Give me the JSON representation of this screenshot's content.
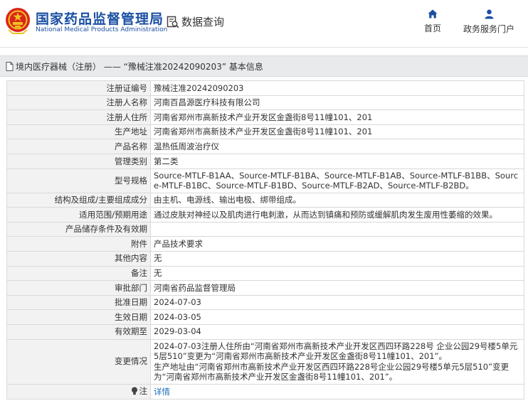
{
  "header": {
    "title": "国家药品监督管理局",
    "subtitle": "National Medical Products Administration",
    "query_label": "数据查询",
    "nav": {
      "home": "首页",
      "services": "政务服务门户"
    }
  },
  "breadcrumb": {
    "text": "境内医疗器械（注册） —— “豫械注准20242090203” 基本信息"
  },
  "rows": [
    {
      "label": "注册证编号",
      "value": "豫械注准20242090203"
    },
    {
      "label": "注册人名称",
      "value": "河南百昌源医疗科技有限公司"
    },
    {
      "label": "注册人住所",
      "value": "河南省郑州市高新技术产业开发区金盏街8号11幢101、201"
    },
    {
      "label": "生产地址",
      "value": "河南省郑州市高新技术产业开发区金盏街8号11幢101、201"
    },
    {
      "label": "产品名称",
      "value": "温热低周波治疗仪"
    },
    {
      "label": "管理类别",
      "value": "第二类"
    },
    {
      "label": "型号规格",
      "value": "Source-MTLF-B1AA、Source-MTLF-B1BA、Source-MTLF-B1AB、Source-MTLF-B1BB、Source-MTLF-B1BC、Source-MTLF-B1BD、Source-MTLF-B2AD、Source-MTLF-B2BD。"
    },
    {
      "label": "结构及组成/主要组成成分",
      "value": "由主机、电源线、输出电极、绑带组成。"
    },
    {
      "label": "适用范围/预期用途",
      "value": "通过皮肤对神经以及肌肉进行电刺激，从而达到镇痛和预防或缓解肌肉发生废用性萎缩的效果。"
    },
    {
      "label": "产品储存条件及有效期",
      "value": ""
    },
    {
      "label": "附件",
      "value": "产品技术要求"
    },
    {
      "label": "其他内容",
      "value": "无"
    },
    {
      "label": "备注",
      "value": "无"
    },
    {
      "label": "审批部门",
      "value": "河南省药品监督管理局"
    },
    {
      "label": "批准日期",
      "value": "2024-07-03"
    },
    {
      "label": "生效日期",
      "value": "2024-03-05"
    },
    {
      "label": "有效期至",
      "value": "2029-03-04"
    },
    {
      "label": "变更情况",
      "value": "2024-07-03注册人住所由“河南省郑州市高新技术产业开发区西四环路228号 企业公园29号楼5单元5层510”变更为“河南省郑州市高新技术产业开发区金盏街8号11幢101、201”。\n生产地址由“河南省郑州市高新技术产业开发区西四环路228号企业公园29号楼5单元5层510”变更为“河南省郑州市高新技术产业开发区金盏街8号11幢101、201”。"
    }
  ],
  "note": {
    "label": "注",
    "link": "详情"
  },
  "colors": {
    "brand": "#1b4fa3",
    "link": "#1b6fb8",
    "label_bg": "#f2f2f2",
    "border": "#d9d9d9"
  }
}
